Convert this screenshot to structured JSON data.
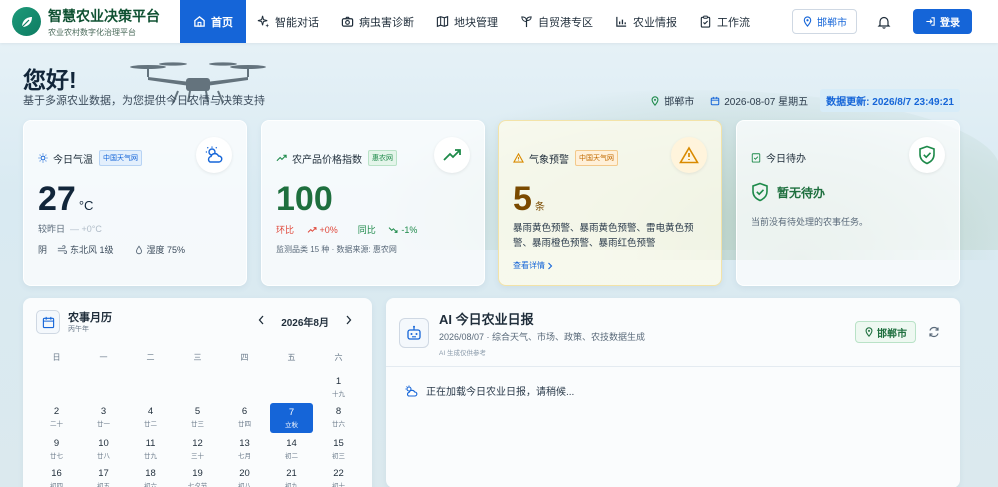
{
  "brand": {
    "title": "智慧农业决策平台",
    "subtitle": "农业农村数字化治理平台"
  },
  "nav": [
    {
      "label": "首页",
      "icon": "home-icon",
      "active": true
    },
    {
      "label": "智能对话",
      "icon": "sparkle-icon"
    },
    {
      "label": "病虫害诊断",
      "icon": "camera-icon"
    },
    {
      "label": "地块管理",
      "icon": "map-icon"
    },
    {
      "label": "自贸港专区",
      "icon": "plant-icon"
    },
    {
      "label": "农业情报",
      "icon": "chart-icon"
    },
    {
      "label": "工作流",
      "icon": "clipboard-icon"
    }
  ],
  "header": {
    "city": "邯郸市",
    "login": "登录"
  },
  "hero": {
    "greeting": "您好!",
    "subtitle": "基于多源农业数据，为您提供今日农情与决策支持",
    "city": "邯郸市",
    "date": "2026-08-07 星期五",
    "update": "数据更新: 2026/8/7 23:49:21"
  },
  "cards": {
    "weather": {
      "title": "今日气温",
      "tag": "中国天气网",
      "value": "27",
      "unit": "°C",
      "compare_label": "较昨日",
      "compare_value": "— +0°C",
      "condition": "阴",
      "wind": "东北风 1级",
      "humidity": "湿度 75%"
    },
    "price": {
      "title": "农产品价格指数",
      "tag": "惠农网",
      "value": "100",
      "ring_label": "环比",
      "ring_value": "+0%",
      "yoy_label": "同比",
      "yoy_value": "-1%",
      "footer": "监测品类 15 种 · 数据来源: 惠农网"
    },
    "alert": {
      "title": "气象预警",
      "tag": "中国天气网",
      "value": "5",
      "unit": "条",
      "text": "暴雨黄色预警、暴雨黄色预警、雷电黄色预警、暴雨橙色预警、暴雨红色预警",
      "link": "查看详情"
    },
    "todo": {
      "title": "今日待办",
      "status": "暂无待办",
      "desc": "当前没有待处理的农事任务。"
    }
  },
  "calendar": {
    "title": "农事月历",
    "subtitle": "丙午年",
    "month": "2026年8月",
    "weekdays": [
      "日",
      "一",
      "二",
      "三",
      "四",
      "五",
      "六"
    ],
    "rows": [
      [
        null,
        null,
        null,
        null,
        null,
        null,
        {
          "n": "1",
          "l": "十九"
        }
      ],
      [
        {
          "n": "2",
          "l": "二十"
        },
        {
          "n": "3",
          "l": "廿一"
        },
        {
          "n": "4",
          "l": "廿二"
        },
        {
          "n": "5",
          "l": "廿三"
        },
        {
          "n": "6",
          "l": "廿四"
        },
        {
          "n": "7",
          "l": "立秋",
          "today": true
        },
        {
          "n": "8",
          "l": "廿六"
        }
      ],
      [
        {
          "n": "9",
          "l": "廿七"
        },
        {
          "n": "10",
          "l": "廿八"
        },
        {
          "n": "11",
          "l": "廿九"
        },
        {
          "n": "12",
          "l": "三十"
        },
        {
          "n": "13",
          "l": "七月"
        },
        {
          "n": "14",
          "l": "初二"
        },
        {
          "n": "15",
          "l": "初三"
        }
      ],
      [
        {
          "n": "16",
          "l": "初四"
        },
        {
          "n": "17",
          "l": "初五"
        },
        {
          "n": "18",
          "l": "初六"
        },
        {
          "n": "19",
          "l": "七夕节"
        },
        {
          "n": "20",
          "l": "初八"
        },
        {
          "n": "21",
          "l": "初九"
        },
        {
          "n": "22",
          "l": "初十"
        }
      ]
    ]
  },
  "ai_report": {
    "title": "AI 今日农业日报",
    "meta": "2026/08/07 · 综合天气、市场、政策、农技数据生成",
    "note": "AI 生成仅供参考",
    "city": "邯郸市",
    "loading": "正在加载今日农业日报，请稍候..."
  }
}
